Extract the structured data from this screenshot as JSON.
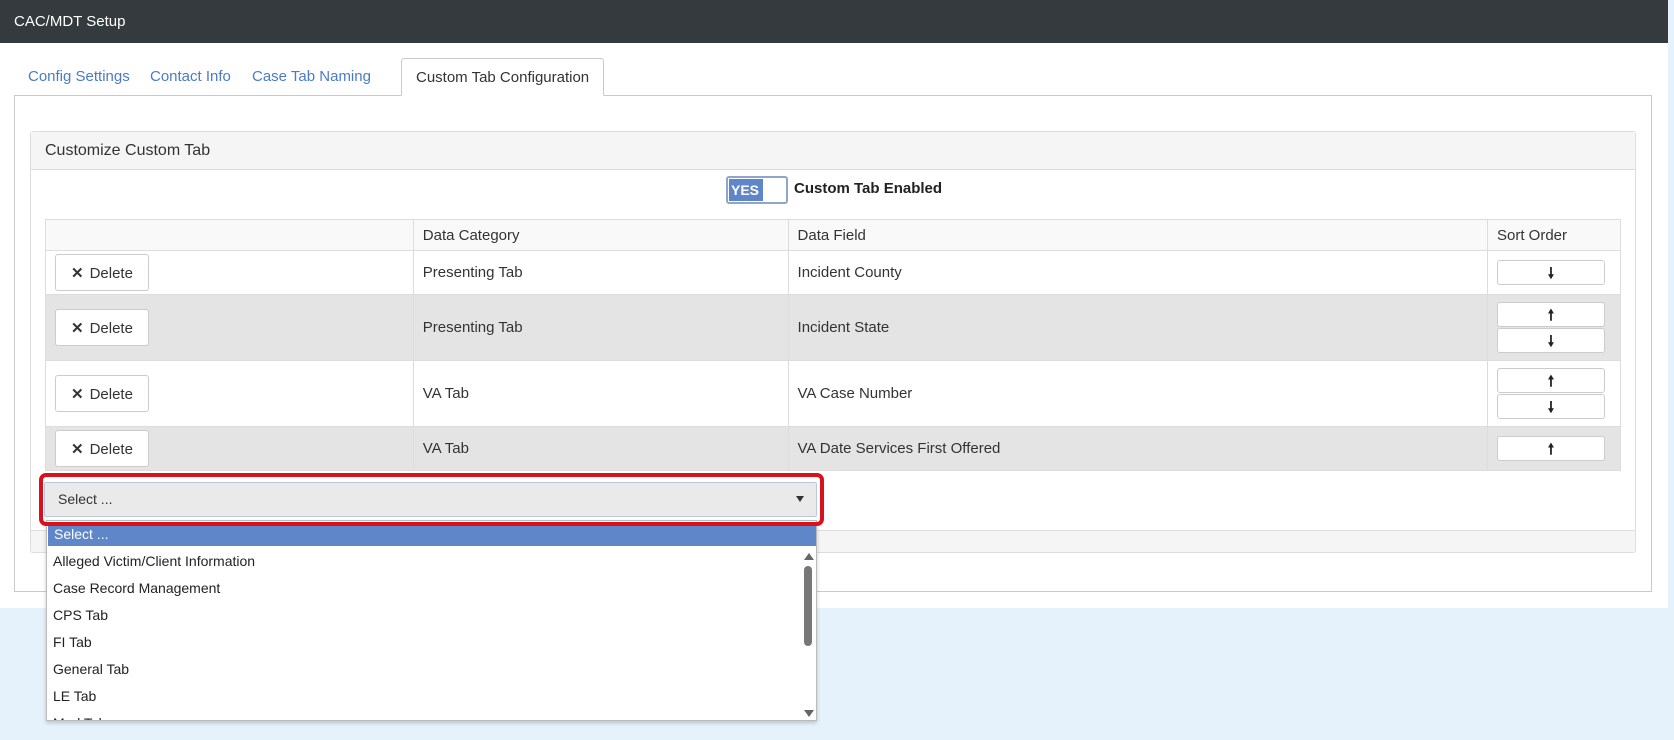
{
  "window_title": "CAC/MDT Setup",
  "tabs": [
    {
      "label": "Config Settings"
    },
    {
      "label": "Contact Info"
    },
    {
      "label": "Case Tab Naming"
    },
    {
      "label": "Custom Tab Configuration",
      "active": true
    }
  ],
  "panel": {
    "heading": "Customize Custom Tab",
    "toggle": {
      "state_label": "YES",
      "label": "Custom Tab Enabled",
      "enabled": true
    }
  },
  "table": {
    "headers": [
      "",
      "Data Category",
      "Data Field",
      "Sort Order"
    ],
    "delete_label": "Delete",
    "delete_icon": "✕",
    "up_arrow": "🠕",
    "down_arrow": "🠗",
    "rows": [
      {
        "category": "Presenting Tab",
        "field": "Incident County"
      },
      {
        "category": "Presenting Tab",
        "field": "Incident State"
      },
      {
        "category": "VA Tab",
        "field": "VA Case Number"
      },
      {
        "category": "VA Tab",
        "field": "VA Date Services First Offered"
      }
    ]
  },
  "select": {
    "value": "Select ...",
    "options": [
      "Select ...",
      "Alleged Victim/Client Information",
      "Case Record Management",
      "CPS Tab",
      "FI Tab",
      "General Tab",
      "LE Tab",
      "Med Tab"
    ]
  },
  "colors": {
    "titlebar": "#343a3e",
    "accent": "#5f86c8",
    "link": "#4a7bc6",
    "highlight": "#d9111c"
  }
}
